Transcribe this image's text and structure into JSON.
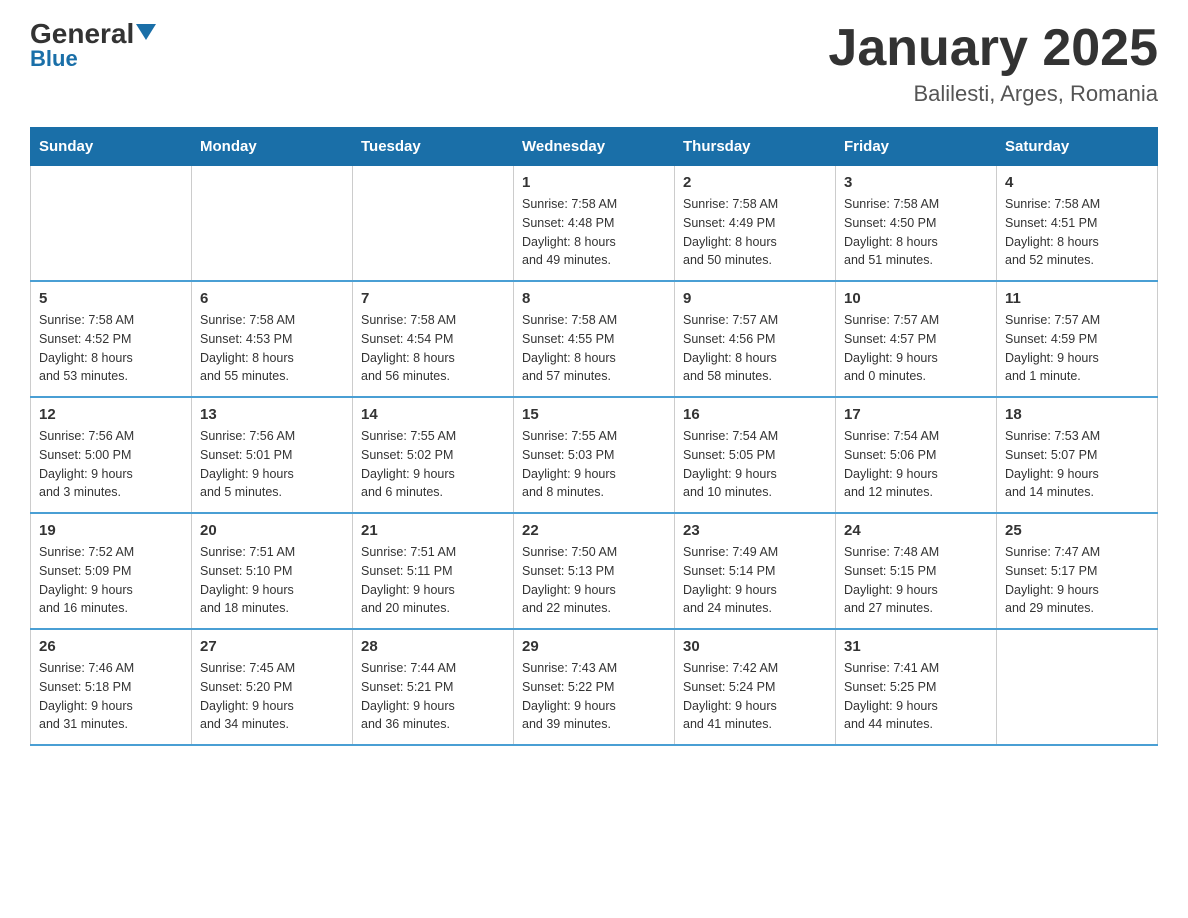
{
  "header": {
    "logo_general": "General",
    "logo_blue": "Blue",
    "month_title": "January 2025",
    "location": "Balilesti, Arges, Romania"
  },
  "weekdays": [
    "Sunday",
    "Monday",
    "Tuesday",
    "Wednesday",
    "Thursday",
    "Friday",
    "Saturday"
  ],
  "weeks": [
    [
      {
        "day": "",
        "info": ""
      },
      {
        "day": "",
        "info": ""
      },
      {
        "day": "",
        "info": ""
      },
      {
        "day": "1",
        "info": "Sunrise: 7:58 AM\nSunset: 4:48 PM\nDaylight: 8 hours\nand 49 minutes."
      },
      {
        "day": "2",
        "info": "Sunrise: 7:58 AM\nSunset: 4:49 PM\nDaylight: 8 hours\nand 50 minutes."
      },
      {
        "day": "3",
        "info": "Sunrise: 7:58 AM\nSunset: 4:50 PM\nDaylight: 8 hours\nand 51 minutes."
      },
      {
        "day": "4",
        "info": "Sunrise: 7:58 AM\nSunset: 4:51 PM\nDaylight: 8 hours\nand 52 minutes."
      }
    ],
    [
      {
        "day": "5",
        "info": "Sunrise: 7:58 AM\nSunset: 4:52 PM\nDaylight: 8 hours\nand 53 minutes."
      },
      {
        "day": "6",
        "info": "Sunrise: 7:58 AM\nSunset: 4:53 PM\nDaylight: 8 hours\nand 55 minutes."
      },
      {
        "day": "7",
        "info": "Sunrise: 7:58 AM\nSunset: 4:54 PM\nDaylight: 8 hours\nand 56 minutes."
      },
      {
        "day": "8",
        "info": "Sunrise: 7:58 AM\nSunset: 4:55 PM\nDaylight: 8 hours\nand 57 minutes."
      },
      {
        "day": "9",
        "info": "Sunrise: 7:57 AM\nSunset: 4:56 PM\nDaylight: 8 hours\nand 58 minutes."
      },
      {
        "day": "10",
        "info": "Sunrise: 7:57 AM\nSunset: 4:57 PM\nDaylight: 9 hours\nand 0 minutes."
      },
      {
        "day": "11",
        "info": "Sunrise: 7:57 AM\nSunset: 4:59 PM\nDaylight: 9 hours\nand 1 minute."
      }
    ],
    [
      {
        "day": "12",
        "info": "Sunrise: 7:56 AM\nSunset: 5:00 PM\nDaylight: 9 hours\nand 3 minutes."
      },
      {
        "day": "13",
        "info": "Sunrise: 7:56 AM\nSunset: 5:01 PM\nDaylight: 9 hours\nand 5 minutes."
      },
      {
        "day": "14",
        "info": "Sunrise: 7:55 AM\nSunset: 5:02 PM\nDaylight: 9 hours\nand 6 minutes."
      },
      {
        "day": "15",
        "info": "Sunrise: 7:55 AM\nSunset: 5:03 PM\nDaylight: 9 hours\nand 8 minutes."
      },
      {
        "day": "16",
        "info": "Sunrise: 7:54 AM\nSunset: 5:05 PM\nDaylight: 9 hours\nand 10 minutes."
      },
      {
        "day": "17",
        "info": "Sunrise: 7:54 AM\nSunset: 5:06 PM\nDaylight: 9 hours\nand 12 minutes."
      },
      {
        "day": "18",
        "info": "Sunrise: 7:53 AM\nSunset: 5:07 PM\nDaylight: 9 hours\nand 14 minutes."
      }
    ],
    [
      {
        "day": "19",
        "info": "Sunrise: 7:52 AM\nSunset: 5:09 PM\nDaylight: 9 hours\nand 16 minutes."
      },
      {
        "day": "20",
        "info": "Sunrise: 7:51 AM\nSunset: 5:10 PM\nDaylight: 9 hours\nand 18 minutes."
      },
      {
        "day": "21",
        "info": "Sunrise: 7:51 AM\nSunset: 5:11 PM\nDaylight: 9 hours\nand 20 minutes."
      },
      {
        "day": "22",
        "info": "Sunrise: 7:50 AM\nSunset: 5:13 PM\nDaylight: 9 hours\nand 22 minutes."
      },
      {
        "day": "23",
        "info": "Sunrise: 7:49 AM\nSunset: 5:14 PM\nDaylight: 9 hours\nand 24 minutes."
      },
      {
        "day": "24",
        "info": "Sunrise: 7:48 AM\nSunset: 5:15 PM\nDaylight: 9 hours\nand 27 minutes."
      },
      {
        "day": "25",
        "info": "Sunrise: 7:47 AM\nSunset: 5:17 PM\nDaylight: 9 hours\nand 29 minutes."
      }
    ],
    [
      {
        "day": "26",
        "info": "Sunrise: 7:46 AM\nSunset: 5:18 PM\nDaylight: 9 hours\nand 31 minutes."
      },
      {
        "day": "27",
        "info": "Sunrise: 7:45 AM\nSunset: 5:20 PM\nDaylight: 9 hours\nand 34 minutes."
      },
      {
        "day": "28",
        "info": "Sunrise: 7:44 AM\nSunset: 5:21 PM\nDaylight: 9 hours\nand 36 minutes."
      },
      {
        "day": "29",
        "info": "Sunrise: 7:43 AM\nSunset: 5:22 PM\nDaylight: 9 hours\nand 39 minutes."
      },
      {
        "day": "30",
        "info": "Sunrise: 7:42 AM\nSunset: 5:24 PM\nDaylight: 9 hours\nand 41 minutes."
      },
      {
        "day": "31",
        "info": "Sunrise: 7:41 AM\nSunset: 5:25 PM\nDaylight: 9 hours\nand 44 minutes."
      },
      {
        "day": "",
        "info": ""
      }
    ]
  ]
}
